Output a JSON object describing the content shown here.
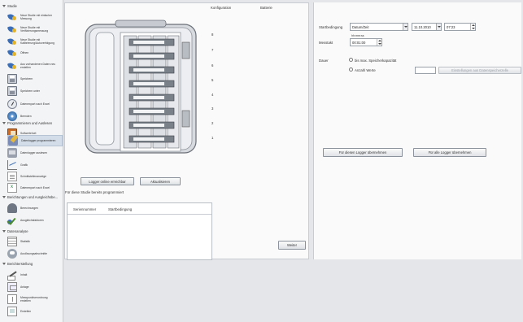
{
  "sidebar": {
    "sections": [
      {
        "label": "Studie"
      },
      {
        "label": "Programmieren und Auslesen"
      },
      {
        "label": "Berichtungen und Ausgleichsbe..."
      },
      {
        "label": "Datenanalyse"
      },
      {
        "label": "Berichterstellung"
      }
    ],
    "items": [
      {
        "label": "Neue Studie mit einfacher\nMessung",
        "icon": "shield-icon"
      },
      {
        "label": "Neue Studie mit\nVerifizierungsmessung",
        "icon": "shield-icon"
      },
      {
        "label": "Neue Studie mit\nKalibrierung/Autoverfolgung",
        "icon": "shield-icon"
      },
      {
        "label": "Öffnen",
        "icon": "shield-icon"
      },
      {
        "label": "Aus vorhandenen Daten neu\nerstellen",
        "icon": "shield-icon"
      },
      {
        "label": "Speichern",
        "icon": "floppy-icon"
      },
      {
        "label": "Speichern unter",
        "icon": "floppy-icon"
      },
      {
        "label": "Datenexport nach Excel",
        "icon": "gauge-icon"
      },
      {
        "label": "Beenden",
        "icon": "disc-icon"
      },
      {
        "label": "Sollwerte/set",
        "icon": "book-icon"
      },
      {
        "label": "Datenlogger programmieren",
        "icon": "config-icon"
      },
      {
        "label": "Datenlogger auslesen",
        "icon": "config2-icon"
      },
      {
        "label": "Grafik",
        "icon": "graph-icon"
      },
      {
        "label": "Schnittstellenanzeige",
        "icon": "doc-icon"
      },
      {
        "label": "Datenexport nach Excel",
        "icon": "xls-icon"
      },
      {
        "label": "Berechnungen",
        "icon": "sensor-icon"
      },
      {
        "label": "Ausgleichsfaktoren",
        "icon": "check-icon"
      },
      {
        "label": "Statistik",
        "icon": "table-icon"
      },
      {
        "label": "Auslösungsabschnitte",
        "icon": "cloud-icon"
      },
      {
        "label": "Inhalt",
        "icon": "pen-icon"
      },
      {
        "label": "Anlage",
        "icon": "board-icon"
      },
      {
        "label": "Messpunktverordnung\nerstellen",
        "icon": "present-icon"
      },
      {
        "label": "Erstellen",
        "icon": "sheet-icon"
      }
    ]
  },
  "middle": {
    "config_label": "Konfiguration",
    "battery_label": "Batterie",
    "slot_numbers": [
      "8",
      "7",
      "6",
      "5",
      "4",
      "3",
      "2",
      "1"
    ],
    "search_button": "Logger online erreichbar",
    "refresh_button": "Aktualisieren",
    "programmed_caption": "Für diese Studie bereits programmiert",
    "table_headers": [
      "Seriennummer",
      "Startbedingung"
    ],
    "next_button": "Weiter"
  },
  "right": {
    "start_condition_label": "Startbedingung",
    "start_condition_value": "Datum/Zeit",
    "date_value": "11.10.2010",
    "time_value": "07:23",
    "interval_units": "hh:mm:ss",
    "interval_label": "Messtakt",
    "interval_value": "00:01:00",
    "duration_label": "Dauer",
    "radio_memory_label": "bis max. Speicherkapazität",
    "radio_count_label": "Anzahl Werte",
    "count_value": "",
    "logger_settings_button": "Einstellungen aus Datenspeicherzelle",
    "apply_this_button": "Für diesen Logger übernehmen",
    "apply_all_button": "Für alle Logger übernehmen"
  }
}
